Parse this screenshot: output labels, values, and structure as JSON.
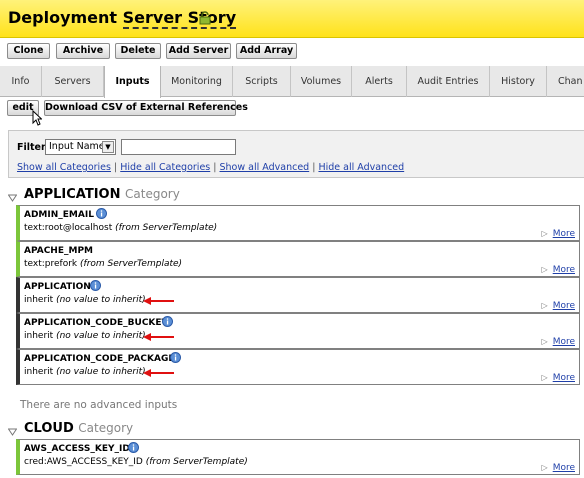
{
  "header": {
    "title_part1": "Deployment ",
    "title_part2": "Server Story"
  },
  "toolbar": {
    "clone": "Clone",
    "archive": "Archive",
    "delete": "Delete",
    "add_server": "Add Server",
    "add_array": "Add Array"
  },
  "tabs": [
    "Info",
    "Servers",
    "Inputs",
    "Monitoring",
    "Scripts",
    "Volumes",
    "Alerts",
    "Audit Entries",
    "History",
    "Chan"
  ],
  "active_tab": "Inputs",
  "actions": {
    "edit": "edit",
    "download_csv": "Download CSV of External References"
  },
  "filter": {
    "label": "Filter",
    "selected_option": "Input Name",
    "input_value": "",
    "links": [
      "Show all Categories",
      "Hide all Categories",
      "Show all Advanced",
      "Hide all Advanced"
    ],
    "separator": " | "
  },
  "categories": [
    {
      "name": "APPLICATION",
      "suffix": "Category",
      "inputs": [
        {
          "name": "ADMIN_EMAIL",
          "value": "text:root@localhost",
          "source": "(from ServerTemplate)",
          "more": "More"
        },
        {
          "name": "APACHE_MPM",
          "value": "text:prefork",
          "source": "(from ServerTemplate)",
          "more": "More"
        },
        {
          "name": "APPLICATION",
          "value": "inherit",
          "source": "(no value to inherit)",
          "more": "More"
        },
        {
          "name": "APPLICATION_CODE_BUCKET",
          "value": "inherit",
          "source": "(no value to inherit)",
          "more": "More"
        },
        {
          "name": "APPLICATION_CODE_PACKAGE",
          "value": "inherit",
          "source": "(no value to inherit)",
          "more": "More"
        }
      ],
      "advanced_note": "There are no advanced inputs"
    },
    {
      "name": "CLOUD",
      "suffix": "Category",
      "inputs": [
        {
          "name": "AWS_ACCESS_KEY_ID",
          "value": "cred:AWS_ACCESS_KEY_ID",
          "source": "(from ServerTemplate)",
          "more": "More"
        }
      ]
    }
  ],
  "colors": {
    "header_yellow": "#ffe21a",
    "set_bar": "#7cc63a",
    "unset_bar": "#333333",
    "annotation_arrow": "#e01010",
    "link": "#1f3fa8"
  },
  "icons": {
    "lock": "lock-icon",
    "info": "info-icon",
    "more": "triangle-right-icon",
    "toggle": "triangle-down-icon",
    "cursor": "mouse-pointer-icon"
  }
}
